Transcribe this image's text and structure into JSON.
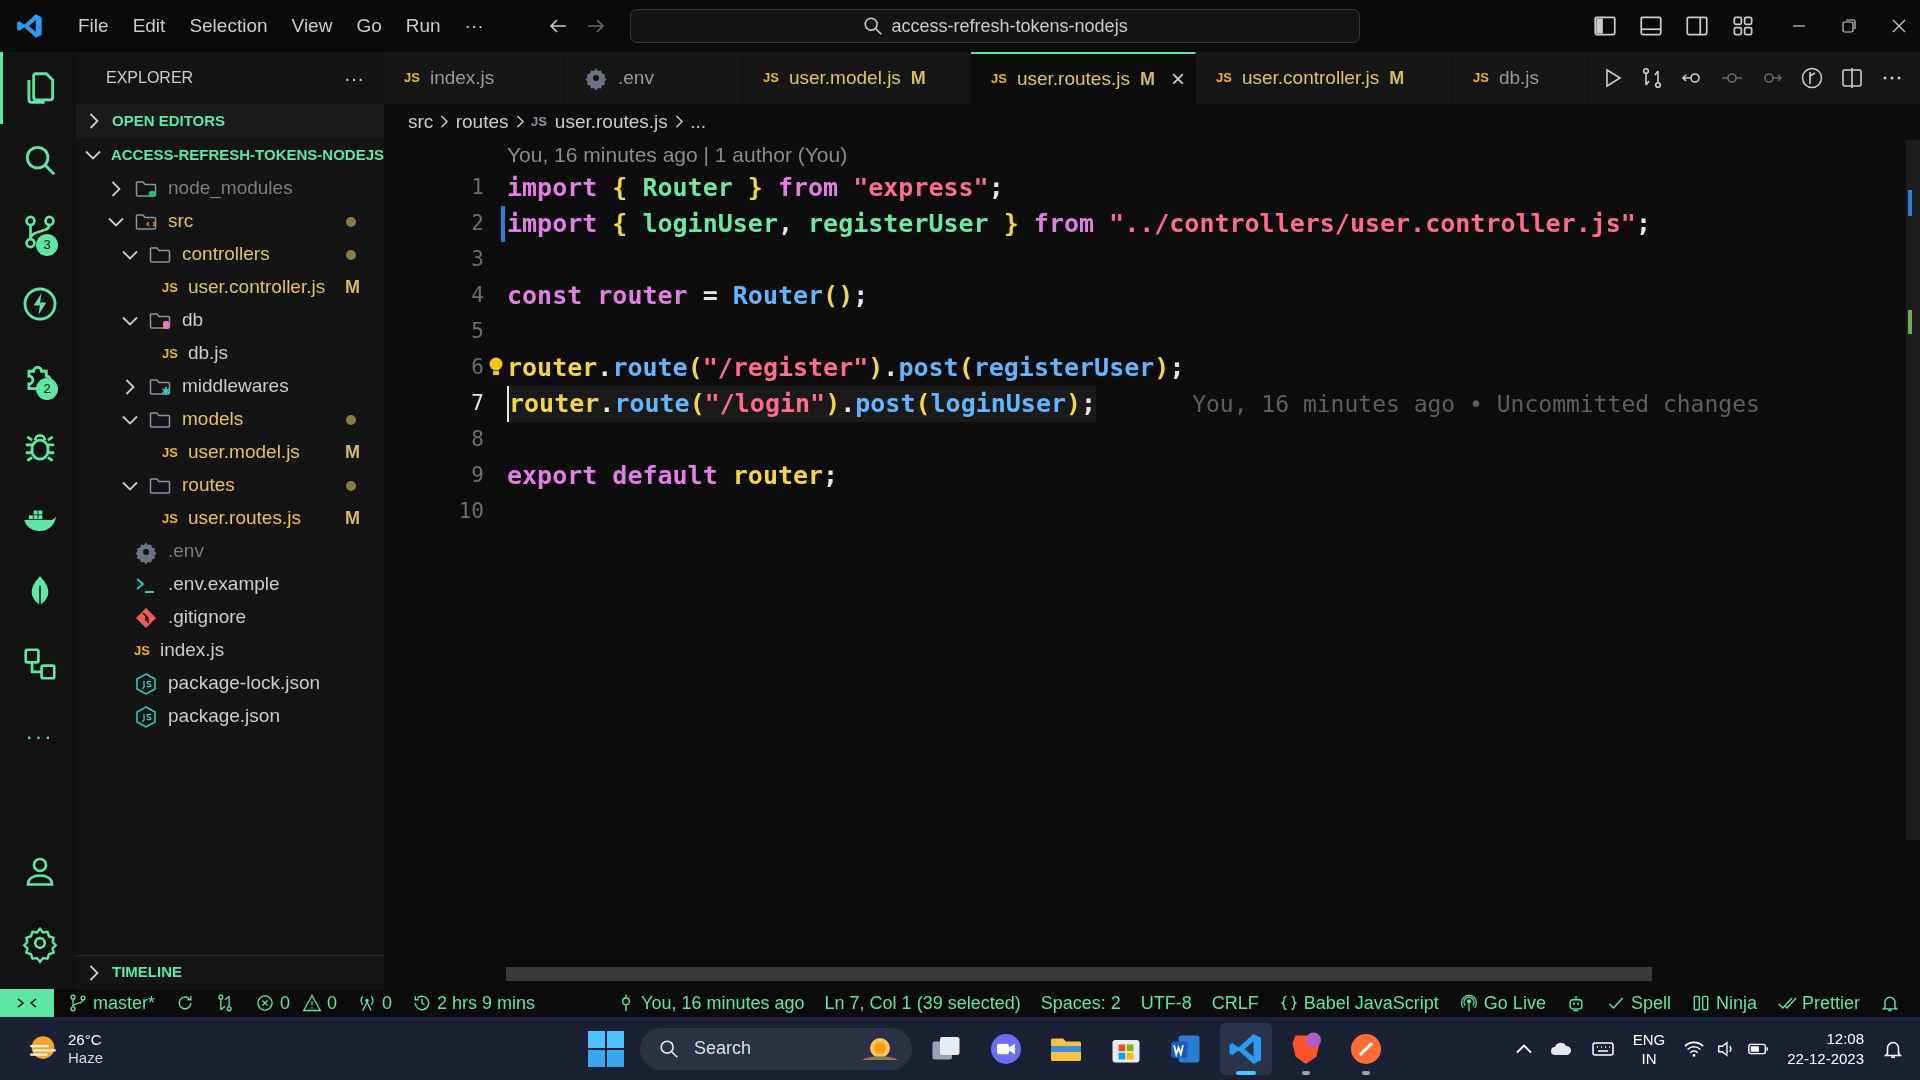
{
  "menu": [
    "File",
    "Edit",
    "Selection",
    "View",
    "Go",
    "Run",
    "···"
  ],
  "command_center": {
    "value": "access-refresh-tokens-nodejs"
  },
  "activity_bar": {
    "items": [
      {
        "selected": true
      },
      {
        "selected": false
      },
      {
        "selected": false,
        "badge": "3"
      },
      {
        "selected": false
      },
      {
        "selected": false,
        "badge": "2"
      },
      {
        "selected": false
      },
      {
        "selected": false
      },
      {
        "selected": false
      },
      {
        "selected": false
      },
      {
        "selected": false,
        "label": "···"
      }
    ],
    "bottom": [
      {
        "selected": false
      },
      {
        "selected": false
      }
    ]
  },
  "sidebar": {
    "title": "EXPLORER",
    "more": "···",
    "sections": [
      {
        "title": "OPEN EDITORS",
        "expanded": false
      },
      {
        "title": "ACCESS-REFRESH-TOKENS-NODEJS",
        "expanded": true
      }
    ],
    "tree": [
      {
        "name": "node_modules",
        "kind": "modules-folder",
        "expanded": false,
        "ignored": true,
        "modified": false,
        "dot": false
      },
      {
        "name": "src",
        "kind": "source-folder",
        "expanded": true,
        "ignored": false,
        "modified": true,
        "dot": true,
        "children": [
          {
            "name": "controllers",
            "kind": "folder",
            "expanded": true,
            "ignored": false,
            "modified": true,
            "dot": true,
            "children": [
              {
                "name": "user.controller.js",
                "kind": "js-file",
                "icon_label": "JS",
                "ignored": false,
                "modified": true,
                "badge": "M",
                "selected": false
              }
            ]
          },
          {
            "name": "db",
            "kind": "database-folder",
            "expanded": true,
            "ignored": false,
            "modified": false,
            "dot": false,
            "children": [
              {
                "name": "db.js",
                "kind": "js-file",
                "icon_label": "JS",
                "ignored": false,
                "modified": false,
                "selected": false
              }
            ]
          },
          {
            "name": "middlewares",
            "kind": "middleware-folder",
            "expanded": false,
            "ignored": false,
            "modified": false,
            "dot": false
          },
          {
            "name": "models",
            "kind": "folder",
            "expanded": true,
            "ignored": false,
            "modified": true,
            "dot": true,
            "children": [
              {
                "name": "user.model.js",
                "kind": "js-file",
                "icon_label": "JS",
                "ignored": false,
                "modified": true,
                "badge": "M",
                "selected": false
              }
            ]
          },
          {
            "name": "routes",
            "kind": "folder",
            "expanded": true,
            "ignored": false,
            "modified": true,
            "dot": true,
            "children": [
              {
                "name": "user.routes.js",
                "kind": "js-file",
                "icon_label": "JS",
                "ignored": false,
                "modified": true,
                "badge": "M",
                "selected": false
              }
            ]
          }
        ]
      },
      {
        "name": ".env",
        "kind": "env-file",
        "ignored": true,
        "modified": false,
        "selected": false
      },
      {
        "name": ".env.example",
        "kind": "shell-file",
        "ignored": false,
        "modified": false,
        "selected": false
      },
      {
        "name": ".gitignore",
        "kind": "git-file",
        "ignored": false,
        "modified": false,
        "selected": false
      },
      {
        "name": "index.js",
        "kind": "js-file",
        "icon_label": "JS",
        "ignored": false,
        "modified": false,
        "selected": false
      },
      {
        "name": "package-lock.json",
        "kind": "json-file",
        "ignored": false,
        "modified": false,
        "selected": false
      },
      {
        "name": "package.json",
        "kind": "json-file",
        "ignored": false,
        "modified": false,
        "selected": false
      }
    ],
    "timeline": {
      "title": "TIMELINE",
      "expanded": false
    }
  },
  "tabs": [
    {
      "label": "index.js",
      "kind": "js-file",
      "icon_label": "JS",
      "selected": false,
      "modified": false
    },
    {
      "label": ".env",
      "kind": "env-file",
      "selected": false,
      "modified": false
    },
    {
      "label": "user.model.js",
      "kind": "js-file",
      "icon_label": "JS",
      "selected": false,
      "modified": true,
      "badge": "M"
    },
    {
      "label": "user.routes.js",
      "kind": "js-file",
      "icon_label": "JS",
      "selected": true,
      "modified": true,
      "badge": "M",
      "close": "×"
    },
    {
      "label": "user.controller.js",
      "kind": "js-file",
      "icon_label": "JS",
      "selected": false,
      "modified": true,
      "badge": "M"
    },
    {
      "label": "db.js",
      "kind": "js-file",
      "icon_label": "JS",
      "selected": false,
      "modified": false
    }
  ],
  "breadcrumb": [
    {
      "text": "src"
    },
    {
      "text": "routes"
    },
    {
      "text": "user.routes.js",
      "icon_label": "JS"
    },
    {
      "text": "..."
    }
  ],
  "editor": {
    "codelens": "You, 16 minutes ago | 1 author (You)",
    "lines": [
      {
        "number": "1",
        "modified": false,
        "tokens": [
          {
            "t": "import ",
            "kind": "keyword"
          },
          {
            "t": "{ ",
            "kind": "brace"
          },
          {
            "t": "Router ",
            "kind": "ident"
          },
          {
            "t": "} ",
            "kind": "brace"
          },
          {
            "t": "from ",
            "kind": "keyword"
          },
          {
            "t": "\"express\"",
            "kind": "string"
          },
          {
            "t": ";",
            "kind": "plain"
          }
        ]
      },
      {
        "number": "2",
        "modified": true,
        "tokens": [
          {
            "t": "import ",
            "kind": "keyword"
          },
          {
            "t": "{ ",
            "kind": "brace"
          },
          {
            "t": "loginUser",
            "kind": "ident"
          },
          {
            "t": ", ",
            "kind": "plain"
          },
          {
            "t": "registerUser ",
            "kind": "ident"
          },
          {
            "t": "} ",
            "kind": "brace"
          },
          {
            "t": "from ",
            "kind": "keyword"
          },
          {
            "t": "\"../controllers/user.controller.js\"",
            "kind": "string"
          },
          {
            "t": ";",
            "kind": "plain"
          }
        ]
      },
      {
        "number": "3",
        "modified": false
      },
      {
        "number": "4",
        "modified": false,
        "tokens": [
          {
            "t": "const ",
            "kind": "keyword"
          },
          {
            "t": "router ",
            "kind": "variable"
          },
          {
            "t": "= ",
            "kind": "plain"
          },
          {
            "t": "Router",
            "kind": "function"
          },
          {
            "t": "()",
            "kind": "brace"
          },
          {
            "t": ";",
            "kind": "plain"
          }
        ]
      },
      {
        "number": "5",
        "modified": false
      },
      {
        "number": "6",
        "modified": false,
        "lightbulb": true,
        "tokens": [
          {
            "t": "router",
            "kind": "object"
          },
          {
            "t": ".",
            "kind": "plain"
          },
          {
            "t": "route",
            "kind": "function"
          },
          {
            "t": "(",
            "kind": "brace"
          },
          {
            "t": "\"/register\"",
            "kind": "string"
          },
          {
            "t": ")",
            "kind": "brace"
          },
          {
            "t": ".",
            "kind": "plain"
          },
          {
            "t": "post",
            "kind": "function"
          },
          {
            "t": "(",
            "kind": "brace"
          },
          {
            "t": "registerUser",
            "kind": "param"
          },
          {
            "t": ")",
            "kind": "brace"
          },
          {
            "t": ";",
            "kind": "plain"
          }
        ]
      },
      {
        "number": "7",
        "modified": false,
        "current": true,
        "blame": "You, 16 minutes ago • Uncommitted changes",
        "tokens": [
          {
            "t": "router",
            "kind": "object"
          },
          {
            "t": ".",
            "kind": "plain"
          },
          {
            "t": "route",
            "kind": "function"
          },
          {
            "t": "(",
            "kind": "brace"
          },
          {
            "t": "\"/login\"",
            "kind": "string"
          },
          {
            "t": ")",
            "kind": "brace"
          },
          {
            "t": ".",
            "kind": "plain"
          },
          {
            "t": "post",
            "kind": "function"
          },
          {
            "t": "(",
            "kind": "brace"
          },
          {
            "t": "loginUser",
            "kind": "param"
          },
          {
            "t": ")",
            "kind": "brace"
          },
          {
            "t": ";",
            "kind": "plain"
          }
        ]
      },
      {
        "number": "8",
        "modified": false
      },
      {
        "number": "9",
        "modified": false,
        "tokens": [
          {
            "t": "export ",
            "kind": "keyword"
          },
          {
            "t": "default ",
            "kind": "keyword"
          },
          {
            "t": "router",
            "kind": "object"
          },
          {
            "t": ";",
            "kind": "plain"
          }
        ]
      },
      {
        "number": "10",
        "modified": false
      }
    ]
  },
  "status_bar": {
    "left": [
      {
        "kind": "branch",
        "text": "master*"
      },
      {
        "kind": "sync"
      },
      {
        "kind": "compare"
      },
      {
        "kind": "error",
        "text": "0"
      },
      {
        "kind": "warning",
        "text": "0"
      },
      {
        "kind": "ports",
        "text": "0"
      },
      {
        "kind": "history",
        "text": "2 hrs 9 mins"
      }
    ],
    "right": [
      {
        "kind": "blame",
        "text": "You, 16 minutes ago"
      },
      {
        "kind": "plain",
        "text": "Ln 7, Col 1 (39 selected)"
      },
      {
        "kind": "plain",
        "text": "Spaces: 2"
      },
      {
        "kind": "plain",
        "text": "UTF-8"
      },
      {
        "kind": "plain",
        "text": "CRLF"
      },
      {
        "kind": "language",
        "text": "Babel JavaScript"
      },
      {
        "kind": "live",
        "text": "Go Live"
      },
      {
        "kind": "robot"
      },
      {
        "kind": "check",
        "text": "Spell"
      },
      {
        "kind": "columns",
        "text": "Ninja"
      },
      {
        "kind": "doublecheck",
        "text": "Prettier"
      },
      {
        "kind": "bell"
      }
    ]
  },
  "taskbar": {
    "weather": {
      "temperature": "26°C",
      "condition": "Haze"
    },
    "search": {
      "placeholder": "Search"
    },
    "apps": [
      {
        "selected": false,
        "running": false
      },
      {
        "selected": false,
        "running": false
      },
      {
        "selected": false,
        "running": false
      },
      {
        "selected": false,
        "running": false
      },
      {
        "selected": false,
        "running": false
      },
      {
        "selected": true,
        "running": true
      },
      {
        "selected": false,
        "running": true
      },
      {
        "selected": false,
        "running": true
      }
    ],
    "language": [
      "ENG",
      "IN"
    ],
    "time": "12:08",
    "date": "22-12-2023"
  }
}
